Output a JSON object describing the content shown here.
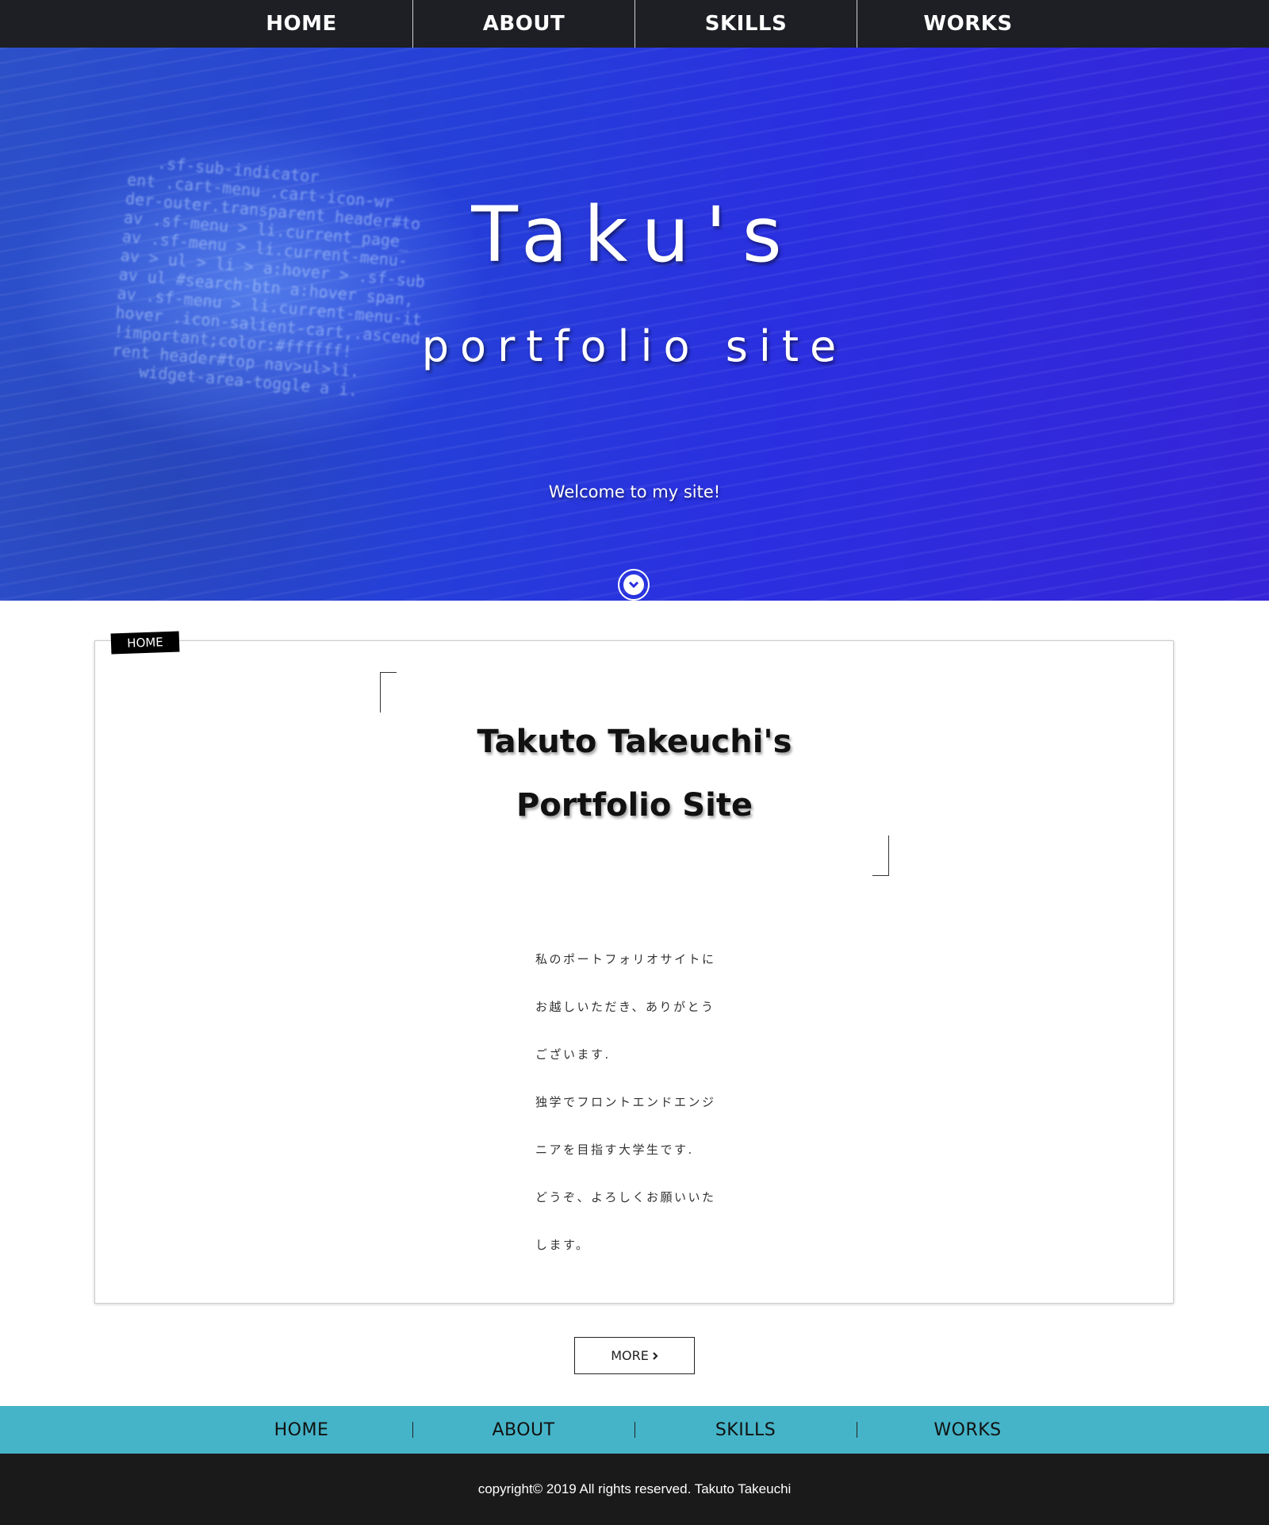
{
  "nav": {
    "items": [
      {
        "label": "HOME"
      },
      {
        "label": "ABOUT"
      },
      {
        "label": "SKILLS"
      },
      {
        "label": "WORKS"
      }
    ]
  },
  "hero": {
    "title": "Taku's",
    "subtitle": "portfolio site",
    "welcome": "Welcome to my site!",
    "scroll_icon": "chevron-down-icon"
  },
  "content": {
    "section_tag": "HOME",
    "heading_line1": "Takuto Takeuchi's",
    "heading_line2": "Portfolio Site",
    "paragraph_lines": [
      "私のポートフォリオサイトに",
      "お越しいただき、ありがとう",
      "ございます.",
      "独学でフロントエンドエンジ",
      "ニアを目指す大学生です.",
      "どうぞ、よろしくお願いいた",
      "します。"
    ],
    "more_label": "MORE",
    "more_icon": "chevron-right-icon"
  },
  "footer_nav": {
    "items": [
      {
        "label": "HOME"
      },
      {
        "label": "ABOUT"
      },
      {
        "label": "SKILLS"
      },
      {
        "label": "WORKS"
      }
    ]
  },
  "copyright": "copyright© 2019 All rights reserved. Takuto Takeuchi",
  "colors": {
    "nav_bg": "#1e1f24",
    "hero_blue": "#2a2fe0",
    "footer_nav_bg": "#45b4c8",
    "footer_bg": "#1a1a1a"
  }
}
